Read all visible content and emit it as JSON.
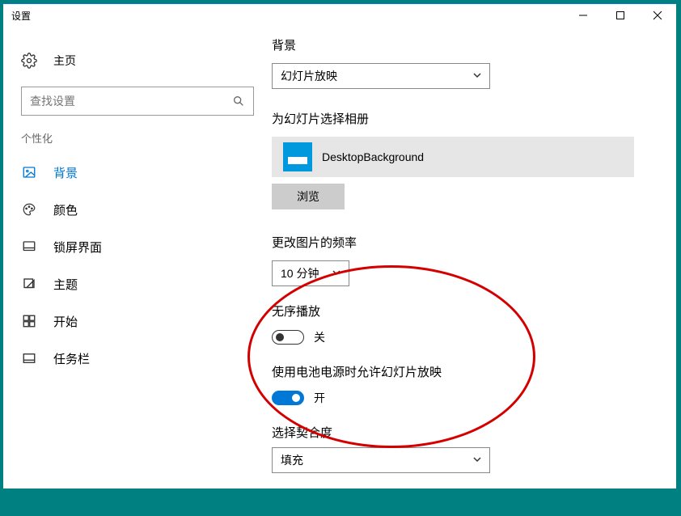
{
  "window": {
    "title": "设置"
  },
  "sidebar": {
    "home": "主页",
    "search_placeholder": "查找设置",
    "category": "个性化",
    "items": [
      {
        "label": "背景"
      },
      {
        "label": "颜色"
      },
      {
        "label": "锁屏界面"
      },
      {
        "label": "主题"
      },
      {
        "label": "开始"
      },
      {
        "label": "任务栏"
      }
    ]
  },
  "content": {
    "background_label": "背景",
    "background_mode": "幻灯片放映",
    "album_label": "为幻灯片选择相册",
    "album_name": "DesktopBackground",
    "browse": "浏览",
    "frequency_label": "更改图片的频率",
    "frequency_value": "10 分钟",
    "shuffle_label": "无序播放",
    "shuffle_state": "关",
    "battery_label": "使用电池电源时允许幻灯片放映",
    "battery_state": "开",
    "fit_label": "选择契合度",
    "fit_value": "填充"
  }
}
